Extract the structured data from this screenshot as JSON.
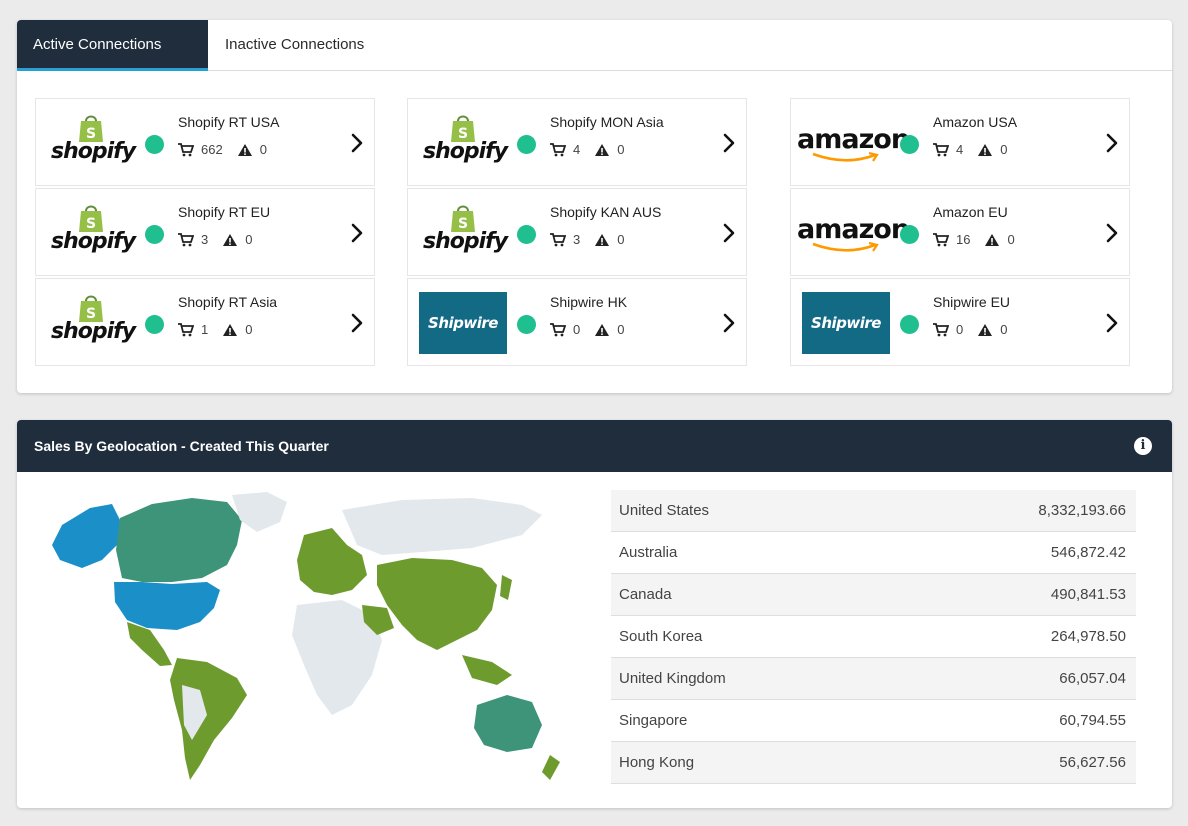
{
  "tabs": [
    {
      "label": "Active Connections",
      "active": true
    },
    {
      "label": "Inactive Connections",
      "active": false
    }
  ],
  "connections": [
    {
      "name": "Shopify RT USA",
      "platform": "shopify",
      "status": "active",
      "orders": "662",
      "warnings": "0"
    },
    {
      "name": "Shopify MON Asia",
      "platform": "shopify",
      "status": "active",
      "orders": "4",
      "warnings": "0"
    },
    {
      "name": "Amazon USA",
      "platform": "amazon",
      "status": "active",
      "orders": "4",
      "warnings": "0"
    },
    {
      "name": "Shopify RT EU",
      "platform": "shopify",
      "status": "active",
      "orders": "3",
      "warnings": "0"
    },
    {
      "name": "Shopify KAN AUS",
      "platform": "shopify",
      "status": "active",
      "orders": "3",
      "warnings": "0"
    },
    {
      "name": "Amazon EU",
      "platform": "amazon",
      "status": "active",
      "orders": "16",
      "warnings": "0"
    },
    {
      "name": "Shopify RT Asia",
      "platform": "shopify",
      "status": "active",
      "orders": "1",
      "warnings": "0"
    },
    {
      "name": "Shipwire HK",
      "platform": "shipwire",
      "status": "active",
      "orders": "0",
      "warnings": "0"
    },
    {
      "name": "Shipwire EU",
      "platform": "shipwire",
      "status": "active",
      "orders": "0",
      "warnings": "0"
    }
  ],
  "logos": {
    "shopify": "shopify",
    "amazon": "amazon",
    "shipwire": "Shipwire"
  },
  "colors": {
    "header_bg": "#1f2d3d",
    "tab_underline": "#2a9fd6",
    "status_active": "#1fbf8f",
    "shipwire_bg": "#126a85",
    "map_top": "#1b8fc8",
    "map_mid": "#3d9479",
    "map_low": "#6e9b2e",
    "map_none": "#e3e8ec"
  },
  "geo": {
    "title": "Sales By Geolocation - Created This Quarter",
    "rows": [
      {
        "country": "United States",
        "amount": "8,332,193.66"
      },
      {
        "country": "Australia",
        "amount": "546,872.42"
      },
      {
        "country": "Canada",
        "amount": "490,841.53"
      },
      {
        "country": "South Korea",
        "amount": "264,978.50"
      },
      {
        "country": "United Kingdom",
        "amount": "66,057.04"
      },
      {
        "country": "Singapore",
        "amount": "60,794.55"
      },
      {
        "country": "Hong Kong",
        "amount": "56,627.56"
      }
    ]
  }
}
